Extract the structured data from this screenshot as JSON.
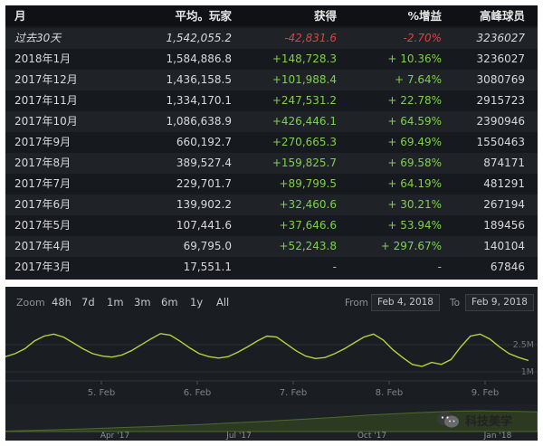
{
  "table": {
    "headers": {
      "month": "月",
      "avg": "平均。玩家",
      "gain": "获得",
      "pct": "%增益",
      "peak": "高峰球员"
    },
    "rows": [
      {
        "month": "过去30天",
        "avg": "1,542,055.2",
        "gain": "-42,831.6",
        "pct": "-2.70%",
        "peak": "3236027",
        "trend": "neg"
      },
      {
        "month": "2018年1月",
        "avg": "1,584,886.8",
        "gain": "+148,728.3",
        "pct": "+ 10.36%",
        "peak": "3236027",
        "trend": "pos"
      },
      {
        "month": "2017年12月",
        "avg": "1,436,158.5",
        "gain": "+101,988.4",
        "pct": "+ 7.64%",
        "peak": "3080769",
        "trend": "pos"
      },
      {
        "month": "2017年11月",
        "avg": "1,334,170.1",
        "gain": "+247,531.2",
        "pct": "+ 22.78%",
        "peak": "2915723",
        "trend": "pos"
      },
      {
        "month": "2017年10月",
        "avg": "1,086,638.9",
        "gain": "+426,446.1",
        "pct": "+ 64.59%",
        "peak": "2390946",
        "trend": "pos"
      },
      {
        "month": "2017年9月",
        "avg": "660,192.7",
        "gain": "+270,665.3",
        "pct": "+ 69.49%",
        "peak": "1550463",
        "trend": "pos"
      },
      {
        "month": "2017年8月",
        "avg": "389,527.4",
        "gain": "+159,825.7",
        "pct": "+ 69.58%",
        "peak": "874171",
        "trend": "pos"
      },
      {
        "month": "2017年7月",
        "avg": "229,701.7",
        "gain": "+89,799.5",
        "pct": "+ 64.19%",
        "peak": "481291",
        "trend": "pos"
      },
      {
        "month": "2017年6月",
        "avg": "139,902.2",
        "gain": "+32,460.6",
        "pct": "+ 30.21%",
        "peak": "267194",
        "trend": "pos"
      },
      {
        "month": "2017年5月",
        "avg": "107,441.6",
        "gain": "+37,646.6",
        "pct": "+ 53.94%",
        "peak": "189456",
        "trend": "pos"
      },
      {
        "month": "2017年4月",
        "avg": "69,795.0",
        "gain": "+52,243.8",
        "pct": "+ 297.67%",
        "peak": "140104",
        "trend": "pos"
      },
      {
        "month": "2017年3月",
        "avg": "17,551.1",
        "gain": "-",
        "pct": "-",
        "peak": "67846",
        "trend": "none"
      }
    ]
  },
  "chart": {
    "zoom_label": "Zoom",
    "zoom_options": [
      "48h",
      "7d",
      "1m",
      "3m",
      "6m",
      "1y",
      "All"
    ],
    "from_label": "From",
    "from_value": "Feb 4, 2018",
    "to_label": "To",
    "to_value": "Feb 9, 2018",
    "y_labels": [
      "2.5M",
      "1M"
    ],
    "x_ticks": [
      "5. Feb",
      "6. Feb",
      "7. Feb",
      "8. Feb",
      "9. Feb"
    ],
    "navigator_ticks": [
      "Apr '17",
      "Jul '17",
      "Oct '17",
      "Jan '18"
    ],
    "line_color": "#b7d23c",
    "series": [
      0.46,
      0.52,
      0.62,
      0.78,
      0.88,
      0.92,
      0.86,
      0.74,
      0.62,
      0.52,
      0.47,
      0.45,
      0.49,
      0.58,
      0.7,
      0.82,
      0.93,
      0.9,
      0.78,
      0.64,
      0.52,
      0.46,
      0.43,
      0.46,
      0.55,
      0.66,
      0.78,
      0.88,
      0.86,
      0.72,
      0.58,
      0.47,
      0.42,
      0.44,
      0.52,
      0.62,
      0.74,
      0.86,
      0.92,
      0.8,
      0.6,
      0.44,
      0.3,
      0.26,
      0.34,
      0.3,
      0.4,
      0.66,
      0.88,
      0.92,
      0.82,
      0.66,
      0.52,
      0.44,
      0.38
    ],
    "navigator_series": [
      0.02,
      0.05,
      0.08,
      0.12,
      0.16,
      0.2,
      0.25,
      0.3,
      0.36,
      0.42,
      0.48,
      0.55,
      0.62,
      0.7,
      0.76,
      0.82,
      0.86,
      0.88,
      0.86,
      0.84
    ]
  },
  "watermark": {
    "text": "科技美学",
    "logo_icon": "wechat-icon"
  }
}
